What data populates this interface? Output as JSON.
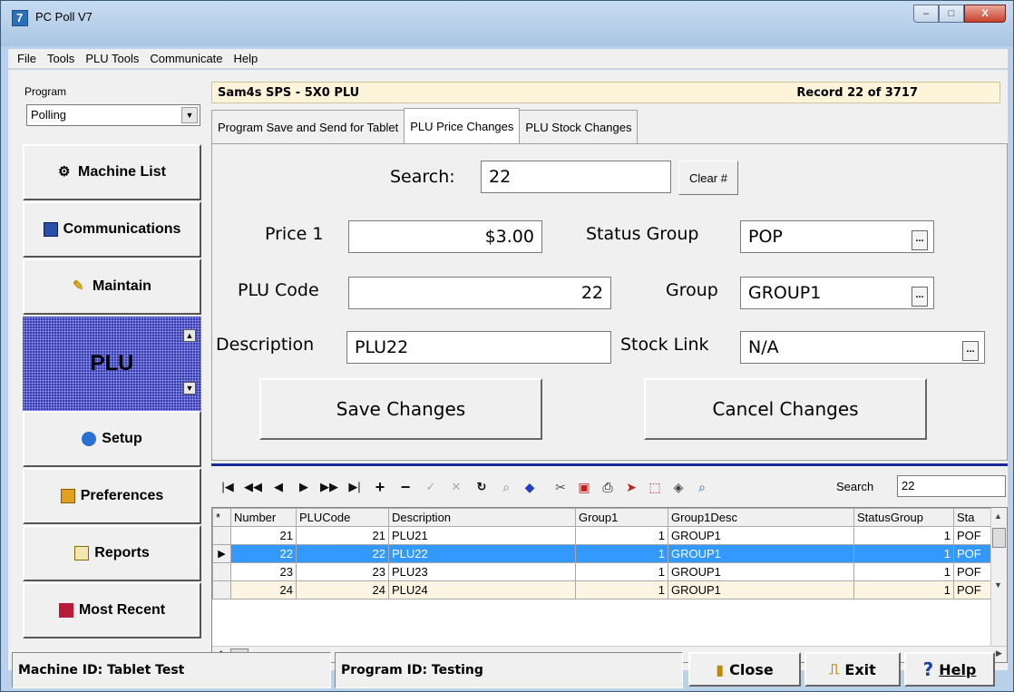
{
  "window": {
    "title": "PC Poll V7",
    "min": "–",
    "max": "□",
    "close": "X"
  },
  "menu": [
    {
      "label": "File"
    },
    {
      "label": "Tools"
    },
    {
      "label": "PLU Tools"
    },
    {
      "label": "Communicate"
    },
    {
      "label": "Help"
    }
  ],
  "program": {
    "label": "Program",
    "value": "Polling"
  },
  "nav": {
    "machine_list": "Machine List",
    "communications": "Communications",
    "maintain": "Maintain",
    "plu": "PLU",
    "setup": "Setup",
    "preferences": "Preferences",
    "reports": "Reports",
    "most_recent": "Most Recent"
  },
  "header": {
    "title": "Sam4s SPS - 5X0 PLU",
    "record": "Record 22 of 3717"
  },
  "tabs": [
    "Program Save and Send for Tablet",
    "PLU Price Changes",
    "PLU Stock Changes"
  ],
  "form": {
    "search_label": "Search:",
    "search_value": "22",
    "clear_label": "Clear #",
    "price1_label": "Price 1",
    "price1_value": "$3.00",
    "plu_code_label": "PLU Code",
    "plu_code_value": "22",
    "description_label": "Description",
    "description_value": "PLU22",
    "status_group_label": "Status Group",
    "status_group_value": "POP",
    "group_label": "Group",
    "group_value": "GROUP1",
    "stock_link_label": "Stock Link",
    "stock_link_value": "N/A",
    "ellipsis": "...",
    "save_label": "Save Changes",
    "cancel_label": "Cancel Changes"
  },
  "toolbar": {
    "search_label": "Search",
    "search_value": "22"
  },
  "grid": {
    "columns": [
      "*",
      "Number",
      "PLUCode",
      "Description",
      "Group1",
      "Group1Desc",
      "StatusGroup",
      "Sta"
    ],
    "rows": [
      {
        "ind": "",
        "number": "21",
        "plucode": "21",
        "description": "PLU21",
        "group1": "1",
        "group1desc": "GROUP1",
        "statusgroup": "1",
        "sta": "POF"
      },
      {
        "ind": "▶",
        "number": "22",
        "plucode": "22",
        "description": "PLU22",
        "group1": "1",
        "group1desc": "GROUP1",
        "statusgroup": "1",
        "sta": "POF"
      },
      {
        "ind": "",
        "number": "23",
        "plucode": "23",
        "description": "PLU23",
        "group1": "1",
        "group1desc": "GROUP1",
        "statusgroup": "1",
        "sta": "POF"
      },
      {
        "ind": "",
        "number": "24",
        "plucode": "24",
        "description": "PLU24",
        "group1": "1",
        "group1desc": "GROUP1",
        "statusgroup": "1",
        "sta": "POF"
      }
    ]
  },
  "status": {
    "machine_id": "Machine ID: Tablet Test",
    "program_id": "Program ID: Testing",
    "close_label": "Close",
    "exit_label": "Exit",
    "help_label": "Help"
  },
  "colors": {
    "selection": "#3399ff",
    "header_strip": "#fdf4d9",
    "plu_panel": "#3a3fb0",
    "divider": "#1b2a9a"
  }
}
